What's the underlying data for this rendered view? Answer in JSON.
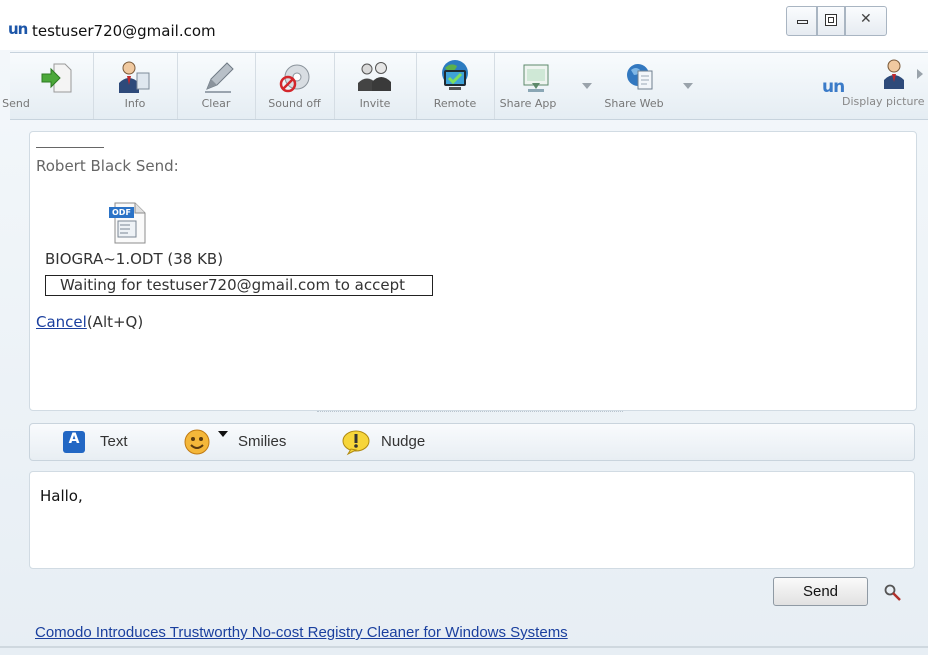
{
  "window": {
    "title": "testuser720@gmail.com",
    "logo": "un"
  },
  "window_controls": {
    "minimize_icon": "minimize-icon",
    "maximize_icon": "maximize-icon",
    "close_icon": "close-icon"
  },
  "toolbar": {
    "items": [
      {
        "label": "Send",
        "icon": "send-file-icon"
      },
      {
        "label": "Info",
        "icon": "contact-info-icon"
      },
      {
        "label": "Clear",
        "icon": "pencil-icon"
      },
      {
        "label": "Sound off",
        "icon": "sound-off-icon"
      },
      {
        "label": "Invite",
        "icon": "invite-people-icon"
      },
      {
        "label": "Remote",
        "icon": "remote-desktop-icon"
      },
      {
        "label": "Share App",
        "icon": "share-app-icon"
      },
      {
        "label": "Share Web",
        "icon": "share-web-icon"
      }
    ],
    "brand": "un",
    "display_picture_label": "Display picture"
  },
  "chat": {
    "sender_line": "Robert Black Send:",
    "file_icon_text": "ODF",
    "file_name": "BIOGRA~1.ODT (38 KB)",
    "status": "Waiting for testuser720@gmail.com to accept",
    "cancel_link": "Cancel",
    "cancel_shortcut": "(Alt+Q)"
  },
  "format_bar": {
    "text_label": "Text",
    "smilies_label": "Smilies",
    "nudge_label": "Nudge",
    "text_badge": "A"
  },
  "input": {
    "value": "Hallo,"
  },
  "send_button": "Send",
  "ad_link": "Comodo Introduces Trustworthy No-cost Registry Cleaner for Windows Systems",
  "colors": {
    "accent": "#1d56a8",
    "link": "#1a3f9e",
    "chrome": "#e7eef4"
  }
}
